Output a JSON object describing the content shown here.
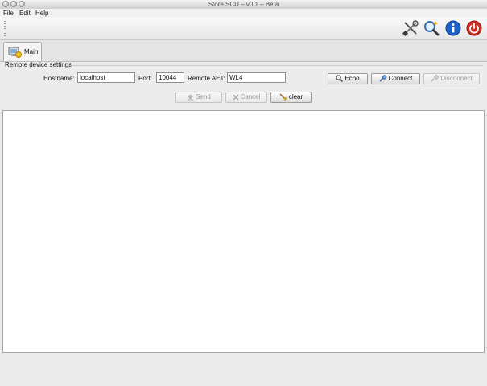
{
  "window": {
    "title": "Store SCU – v0.1 – Beta"
  },
  "menu": [
    "File",
    "Edit",
    "Help"
  ],
  "toolbar": {
    "icons": [
      "settings-tools-icon",
      "search-icon",
      "info-icon",
      "power-icon"
    ]
  },
  "tabs": [
    {
      "label": "Main"
    }
  ],
  "remote": {
    "section_title": "Remote device settings",
    "hostname_label": "Hostname:",
    "hostname_value": "localhost",
    "port_label": "Port:",
    "port_value": "10044",
    "aet_label": "Remote AET:",
    "aet_value": "WL4"
  },
  "buttons": {
    "echo": "Echo",
    "connect": "Connect",
    "disconnect": "Disconnect",
    "send": "Send",
    "cancel": "Cancel",
    "clear": "clear"
  },
  "colors": {
    "info": "#1f5fc8",
    "power": "#d12b1f"
  }
}
